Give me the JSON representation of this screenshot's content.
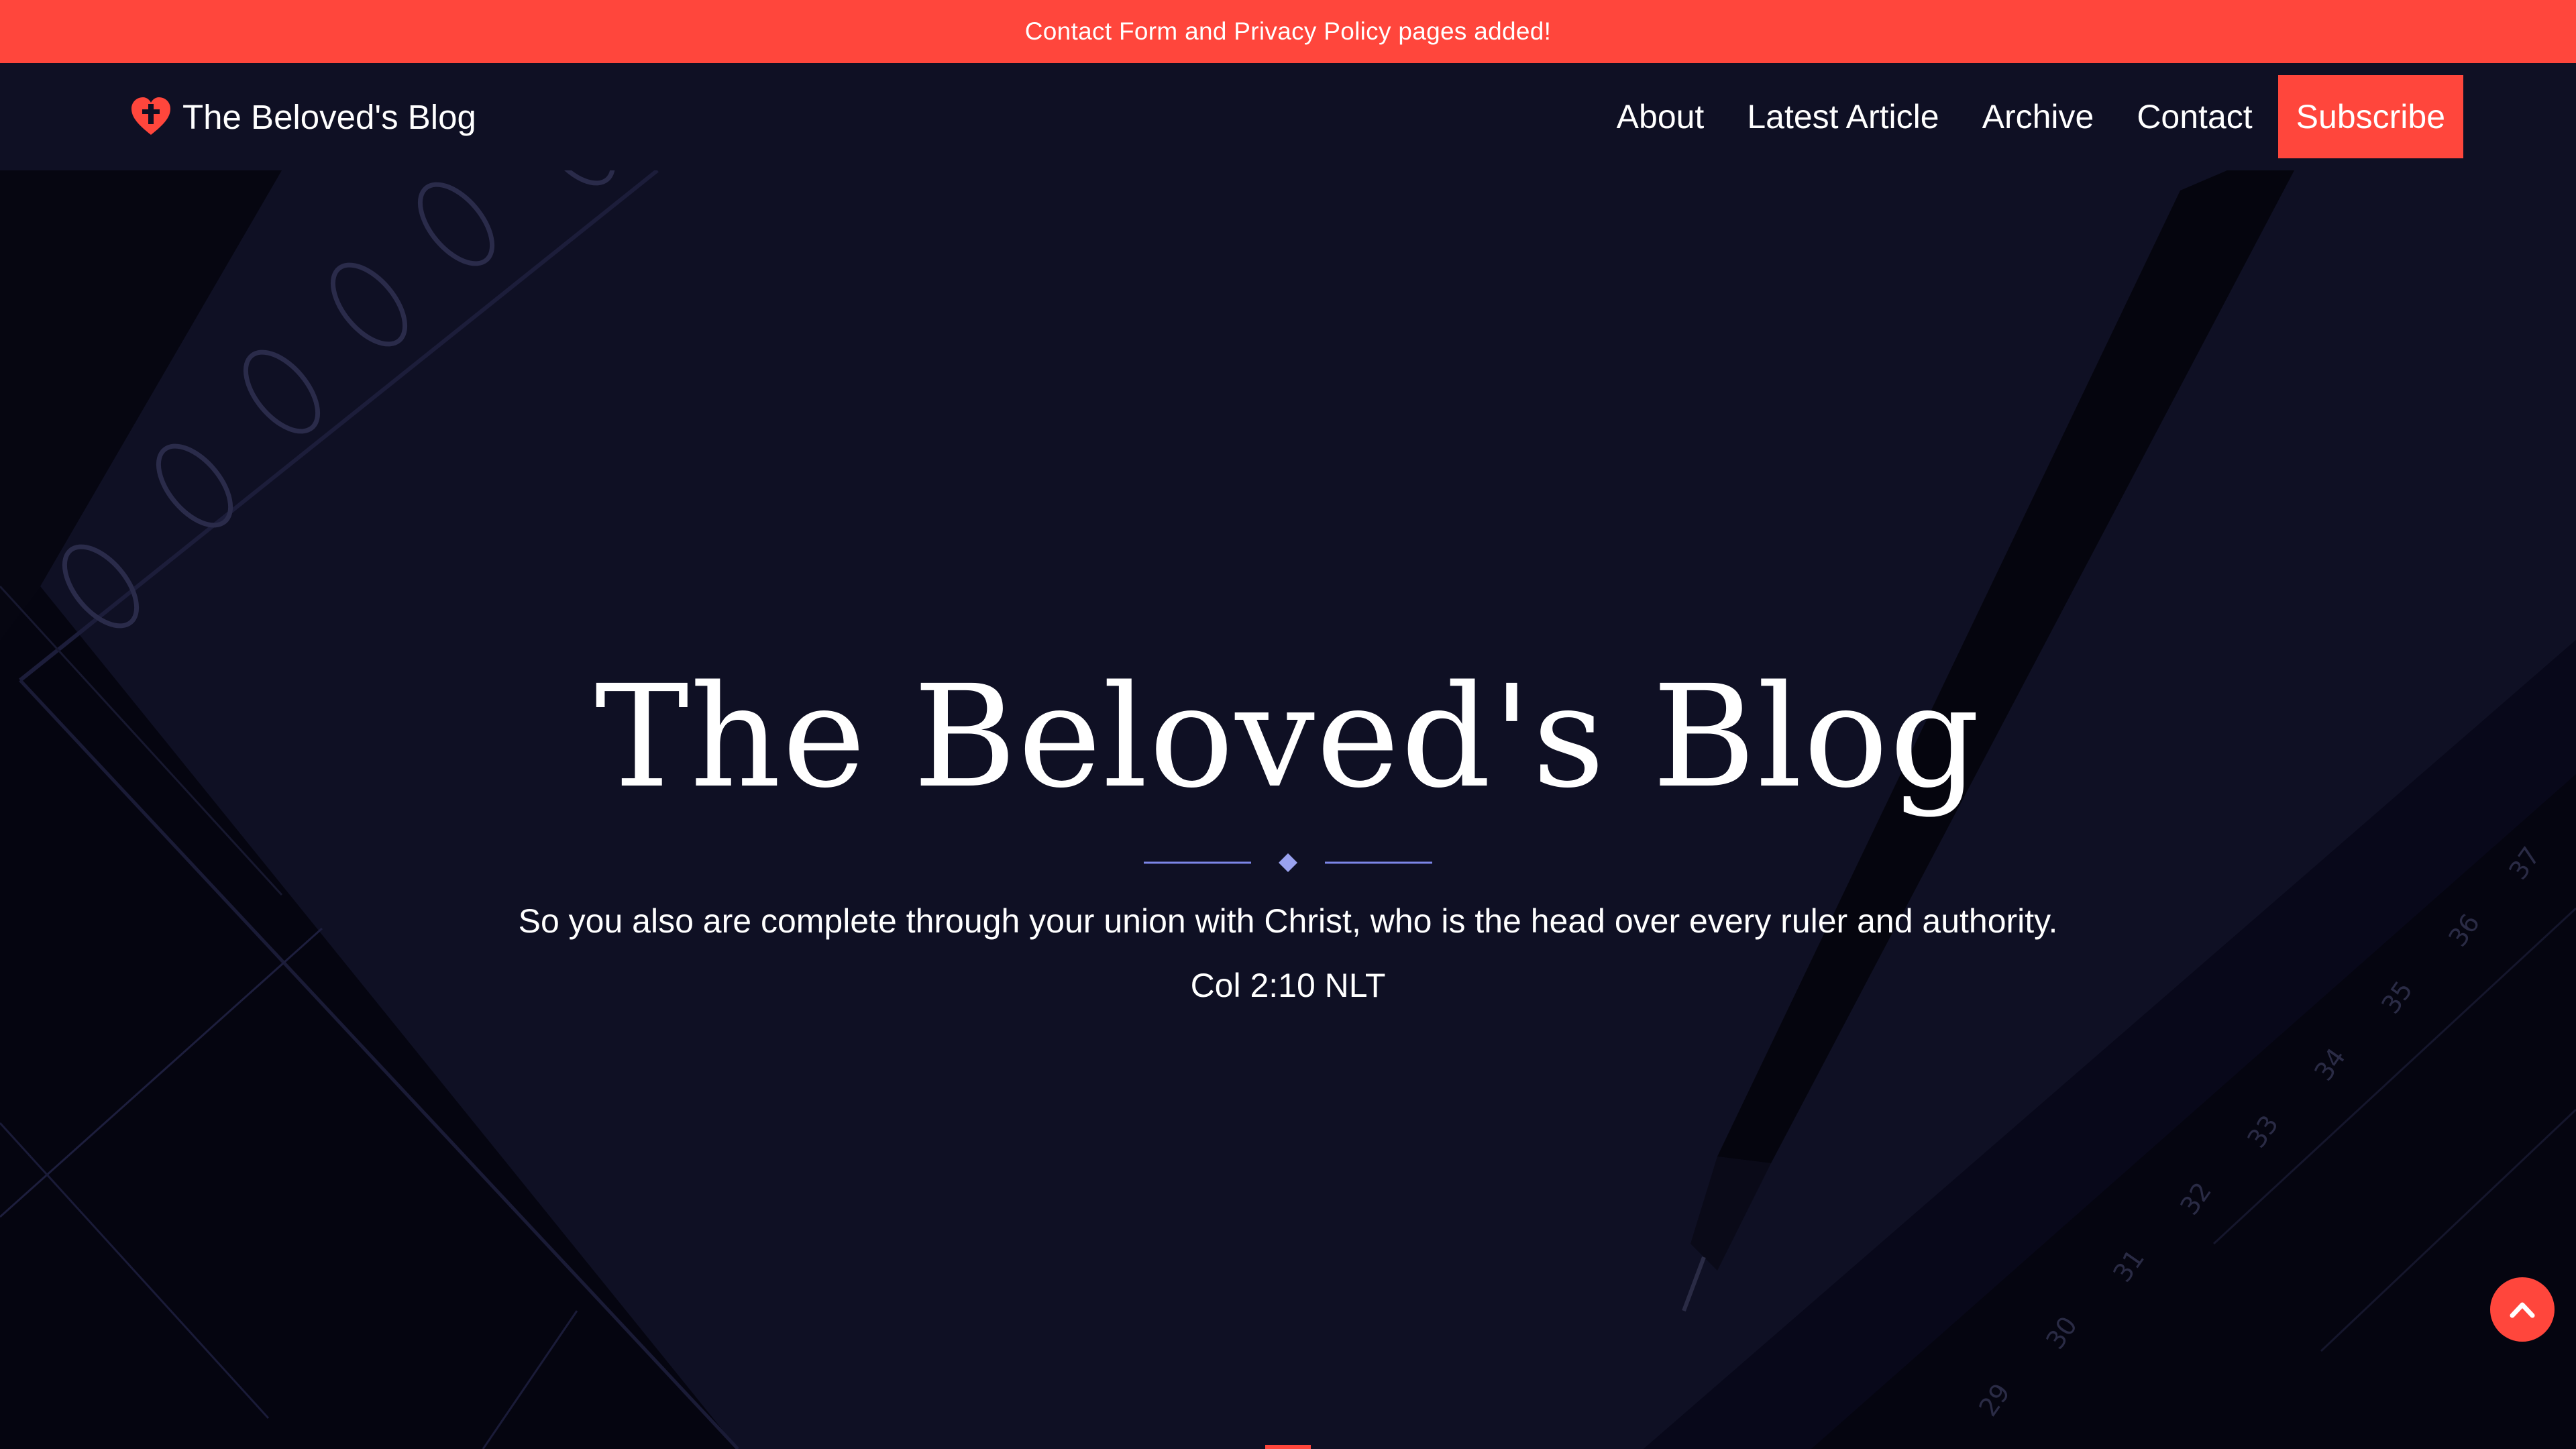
{
  "announcement": {
    "text": "Contact Form and Privacy Policy pages added!"
  },
  "navbar": {
    "brand": "The Beloved's Blog",
    "brand_icon": "heart-cross-icon",
    "links": [
      {
        "label": "About"
      },
      {
        "label": "Latest Article"
      },
      {
        "label": "Archive"
      },
      {
        "label": "Contact"
      }
    ],
    "subscribe_label": "Subscribe"
  },
  "hero": {
    "title": "The Beloved's Blog",
    "verse": "So you also are complete through your union with Christ, who is the head over every ruler and authority.",
    "reference": "Col 2:10 NLT"
  },
  "scroll_top": {
    "icon": "chevron-up-icon"
  },
  "colors": {
    "accent": "#ff463c",
    "background": "#0f1024",
    "divider": "#7c86e8"
  }
}
